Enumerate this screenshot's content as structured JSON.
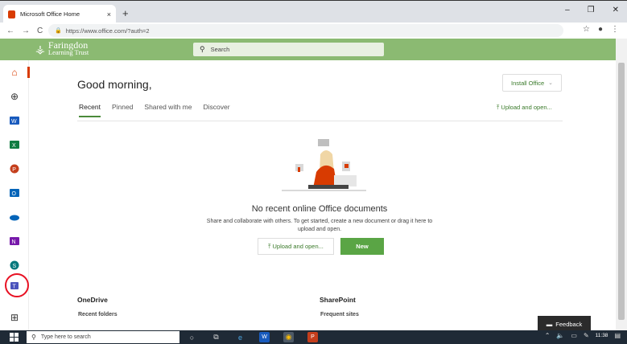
{
  "browser": {
    "tab_title": "Microsoft Office Home",
    "close_tab": "×",
    "new_tab": "+",
    "window_controls": [
      "–",
      "❐",
      "✕"
    ],
    "url": "https://www.office.com/?auth=2"
  },
  "header": {
    "org_line1": "Faringdon",
    "org_line2": "Learning Trust",
    "search_placeholder": "Search",
    "brand_color": "#8bba72"
  },
  "main": {
    "greeting": "Good morning,",
    "install_label": "Install Office",
    "tabs": [
      {
        "label": "Recent"
      },
      {
        "label": "Pinned"
      },
      {
        "label": "Shared with me"
      },
      {
        "label": "Discover"
      }
    ],
    "upload_top": "Upload and open...",
    "empty_title": "No recent online Office documents",
    "empty_desc": "Share and collaborate with others. To get started, create a new document or drag it here to upload and open.",
    "upload_button": "Upload and open...",
    "new_button": "New",
    "onedrive_title": "OneDrive",
    "onedrive_sub": "Recent folders",
    "sharepoint_title": "SharePoint",
    "sharepoint_sub": "Frequent sites",
    "feedback": "Feedback"
  },
  "rail": {
    "items": [
      {
        "icon": "home-icon",
        "color": "#d83b01"
      },
      {
        "icon": "create-icon",
        "color": "#333333"
      },
      {
        "icon": "word-icon",
        "color": "#185abd"
      },
      {
        "icon": "excel-icon",
        "color": "#107c41"
      },
      {
        "icon": "powerpoint-icon",
        "color": "#c43e1c"
      },
      {
        "icon": "outlook-icon",
        "color": "#0364b8"
      },
      {
        "icon": "onedrive-icon",
        "color": "#0364b8"
      },
      {
        "icon": "onenote-icon",
        "color": "#7719aa"
      },
      {
        "icon": "sharepoint-icon",
        "color": "#03787c"
      },
      {
        "icon": "teams-icon",
        "color": "#4b53bc"
      },
      {
        "icon": "apps-icon",
        "color": "#333333"
      }
    ]
  },
  "taskbar": {
    "search_placeholder": "Type here to search",
    "time": "11:38"
  }
}
